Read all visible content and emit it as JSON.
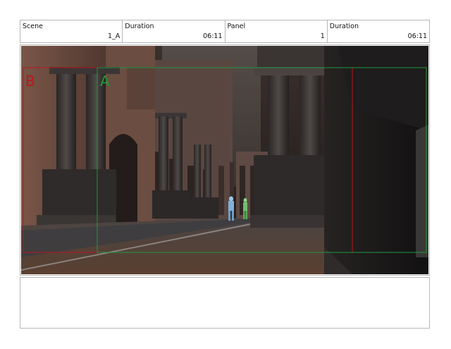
{
  "header": {
    "cells": [
      {
        "label": "Scene",
        "value": "1_A"
      },
      {
        "label": "Duration",
        "value": "06:11"
      },
      {
        "label": "Panel",
        "value": "1"
      },
      {
        "label": "Duration",
        "value": "06:11"
      }
    ]
  },
  "guides": {
    "camera_b": {
      "label": "B",
      "color": "#c0141c"
    },
    "camera_a": {
      "label": "A",
      "color": "#1f9a3a"
    }
  },
  "notes": {
    "text": ""
  }
}
